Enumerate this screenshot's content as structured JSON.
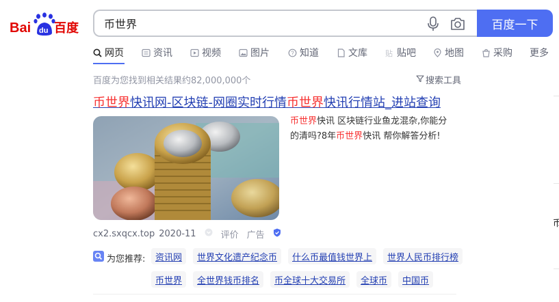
{
  "header": {
    "logo_text_left": "Bai",
    "logo_text_du": "du",
    "logo_text_cn": "百度",
    "search_value": "币世界",
    "search_button_label": "百度一下"
  },
  "tabs": [
    {
      "label": "网页",
      "icon": "search-icon",
      "active": true
    },
    {
      "label": "资讯",
      "icon": "news-icon"
    },
    {
      "label": "视频",
      "icon": "video-icon"
    },
    {
      "label": "图片",
      "icon": "image-icon"
    },
    {
      "label": "知道",
      "icon": "question-icon"
    },
    {
      "label": "文库",
      "icon": "document-icon"
    },
    {
      "label": "贴吧",
      "icon": "tieba-icon"
    },
    {
      "label": "地图",
      "icon": "map-pin-icon"
    },
    {
      "label": "采购",
      "icon": "shopping-icon"
    },
    {
      "label": "更多",
      "icon": ""
    }
  ],
  "results_info": {
    "count_text": "百度为您找到相关结果约82,000,000个",
    "tools_label": "搜索工具"
  },
  "result": {
    "title_parts": [
      {
        "text": "币世界",
        "highlight": true
      },
      {
        "text": "快讯网-区块链-网圈实时行情",
        "highlight": false
      },
      {
        "text": "币世界",
        "highlight": true
      },
      {
        "text": "快讯行情站_进站查询",
        "highlight": false
      }
    ],
    "snippet_parts": [
      {
        "text": "币世界",
        "highlight": true
      },
      {
        "text": "快讯 区块链行业鱼龙混杂,你能分的清吗?8年",
        "highlight": false
      },
      {
        "text": "币世界",
        "highlight": true
      },
      {
        "text": "快讯 帮你解答分析!",
        "highlight": false
      }
    ],
    "domain": "cx2.sxqcx.top",
    "date": "2020-11",
    "review_label": "评价",
    "ad_label": "广告"
  },
  "recommendations": {
    "label": "为您推荐:",
    "items": [
      "资讯网",
      "世界文化遗产纪念币",
      "什么币最值钱世界上",
      "世界人民币排行榜",
      "币世界",
      "全世界钱币排名",
      "币全球十大交易所",
      "全球币",
      "中国币"
    ]
  },
  "right_panel": {
    "cut_char": "币"
  },
  "colors": {
    "accent": "#4e6ef2",
    "link": "#2440b3",
    "highlight": "#f73131",
    "logo_red": "#e10602",
    "logo_blue": "#2932e1"
  }
}
